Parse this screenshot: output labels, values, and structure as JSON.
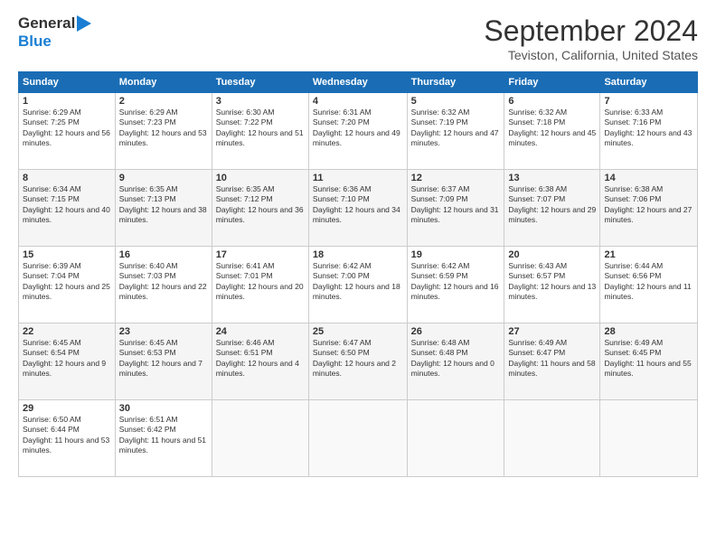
{
  "header": {
    "logo_general": "General",
    "logo_blue": "Blue",
    "month_title": "September 2024",
    "subtitle": "Teviston, California, United States"
  },
  "days_of_week": [
    "Sunday",
    "Monday",
    "Tuesday",
    "Wednesday",
    "Thursday",
    "Friday",
    "Saturday"
  ],
  "weeks": [
    [
      {
        "day": "1",
        "sunrise": "Sunrise: 6:29 AM",
        "sunset": "Sunset: 7:25 PM",
        "daylight": "Daylight: 12 hours and 56 minutes."
      },
      {
        "day": "2",
        "sunrise": "Sunrise: 6:29 AM",
        "sunset": "Sunset: 7:23 PM",
        "daylight": "Daylight: 12 hours and 53 minutes."
      },
      {
        "day": "3",
        "sunrise": "Sunrise: 6:30 AM",
        "sunset": "Sunset: 7:22 PM",
        "daylight": "Daylight: 12 hours and 51 minutes."
      },
      {
        "day": "4",
        "sunrise": "Sunrise: 6:31 AM",
        "sunset": "Sunset: 7:20 PM",
        "daylight": "Daylight: 12 hours and 49 minutes."
      },
      {
        "day": "5",
        "sunrise": "Sunrise: 6:32 AM",
        "sunset": "Sunset: 7:19 PM",
        "daylight": "Daylight: 12 hours and 47 minutes."
      },
      {
        "day": "6",
        "sunrise": "Sunrise: 6:32 AM",
        "sunset": "Sunset: 7:18 PM",
        "daylight": "Daylight: 12 hours and 45 minutes."
      },
      {
        "day": "7",
        "sunrise": "Sunrise: 6:33 AM",
        "sunset": "Sunset: 7:16 PM",
        "daylight": "Daylight: 12 hours and 43 minutes."
      }
    ],
    [
      {
        "day": "8",
        "sunrise": "Sunrise: 6:34 AM",
        "sunset": "Sunset: 7:15 PM",
        "daylight": "Daylight: 12 hours and 40 minutes."
      },
      {
        "day": "9",
        "sunrise": "Sunrise: 6:35 AM",
        "sunset": "Sunset: 7:13 PM",
        "daylight": "Daylight: 12 hours and 38 minutes."
      },
      {
        "day": "10",
        "sunrise": "Sunrise: 6:35 AM",
        "sunset": "Sunset: 7:12 PM",
        "daylight": "Daylight: 12 hours and 36 minutes."
      },
      {
        "day": "11",
        "sunrise": "Sunrise: 6:36 AM",
        "sunset": "Sunset: 7:10 PM",
        "daylight": "Daylight: 12 hours and 34 minutes."
      },
      {
        "day": "12",
        "sunrise": "Sunrise: 6:37 AM",
        "sunset": "Sunset: 7:09 PM",
        "daylight": "Daylight: 12 hours and 31 minutes."
      },
      {
        "day": "13",
        "sunrise": "Sunrise: 6:38 AM",
        "sunset": "Sunset: 7:07 PM",
        "daylight": "Daylight: 12 hours and 29 minutes."
      },
      {
        "day": "14",
        "sunrise": "Sunrise: 6:38 AM",
        "sunset": "Sunset: 7:06 PM",
        "daylight": "Daylight: 12 hours and 27 minutes."
      }
    ],
    [
      {
        "day": "15",
        "sunrise": "Sunrise: 6:39 AM",
        "sunset": "Sunset: 7:04 PM",
        "daylight": "Daylight: 12 hours and 25 minutes."
      },
      {
        "day": "16",
        "sunrise": "Sunrise: 6:40 AM",
        "sunset": "Sunset: 7:03 PM",
        "daylight": "Daylight: 12 hours and 22 minutes."
      },
      {
        "day": "17",
        "sunrise": "Sunrise: 6:41 AM",
        "sunset": "Sunset: 7:01 PM",
        "daylight": "Daylight: 12 hours and 20 minutes."
      },
      {
        "day": "18",
        "sunrise": "Sunrise: 6:42 AM",
        "sunset": "Sunset: 7:00 PM",
        "daylight": "Daylight: 12 hours and 18 minutes."
      },
      {
        "day": "19",
        "sunrise": "Sunrise: 6:42 AM",
        "sunset": "Sunset: 6:59 PM",
        "daylight": "Daylight: 12 hours and 16 minutes."
      },
      {
        "day": "20",
        "sunrise": "Sunrise: 6:43 AM",
        "sunset": "Sunset: 6:57 PM",
        "daylight": "Daylight: 12 hours and 13 minutes."
      },
      {
        "day": "21",
        "sunrise": "Sunrise: 6:44 AM",
        "sunset": "Sunset: 6:56 PM",
        "daylight": "Daylight: 12 hours and 11 minutes."
      }
    ],
    [
      {
        "day": "22",
        "sunrise": "Sunrise: 6:45 AM",
        "sunset": "Sunset: 6:54 PM",
        "daylight": "Daylight: 12 hours and 9 minutes."
      },
      {
        "day": "23",
        "sunrise": "Sunrise: 6:45 AM",
        "sunset": "Sunset: 6:53 PM",
        "daylight": "Daylight: 12 hours and 7 minutes."
      },
      {
        "day": "24",
        "sunrise": "Sunrise: 6:46 AM",
        "sunset": "Sunset: 6:51 PM",
        "daylight": "Daylight: 12 hours and 4 minutes."
      },
      {
        "day": "25",
        "sunrise": "Sunrise: 6:47 AM",
        "sunset": "Sunset: 6:50 PM",
        "daylight": "Daylight: 12 hours and 2 minutes."
      },
      {
        "day": "26",
        "sunrise": "Sunrise: 6:48 AM",
        "sunset": "Sunset: 6:48 PM",
        "daylight": "Daylight: 12 hours and 0 minutes."
      },
      {
        "day": "27",
        "sunrise": "Sunrise: 6:49 AM",
        "sunset": "Sunset: 6:47 PM",
        "daylight": "Daylight: 11 hours and 58 minutes."
      },
      {
        "day": "28",
        "sunrise": "Sunrise: 6:49 AM",
        "sunset": "Sunset: 6:45 PM",
        "daylight": "Daylight: 11 hours and 55 minutes."
      }
    ],
    [
      {
        "day": "29",
        "sunrise": "Sunrise: 6:50 AM",
        "sunset": "Sunset: 6:44 PM",
        "daylight": "Daylight: 11 hours and 53 minutes."
      },
      {
        "day": "30",
        "sunrise": "Sunrise: 6:51 AM",
        "sunset": "Sunset: 6:42 PM",
        "daylight": "Daylight: 11 hours and 51 minutes."
      },
      null,
      null,
      null,
      null,
      null
    ]
  ]
}
